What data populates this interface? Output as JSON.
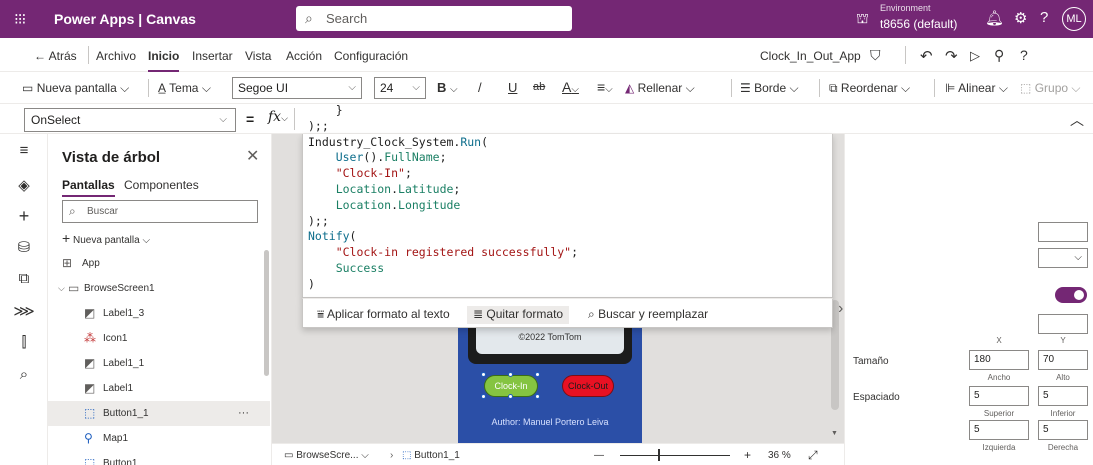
{
  "header": {
    "waffle": "⁝⁝⁝",
    "app_title": "Power Apps  |  Canvas",
    "search_placeholder": "Search",
    "env_label": "Environment",
    "env_name": "t8656 (default)",
    "avatar": "ML"
  },
  "menubar": {
    "back": "Atrás",
    "items": [
      "Archivo",
      "Inicio",
      "Insertar",
      "Vista",
      "Acción",
      "Configuración"
    ],
    "active": "Inicio",
    "app_name": "Clock_In_Out_App"
  },
  "ribbon": {
    "new_screen": "Nueva pantalla",
    "theme": "Tema",
    "font": "Segoe UI",
    "font_size": "24",
    "bold": "B",
    "italic": "/",
    "underline": "U",
    "strike": "ab",
    "font_color": "A",
    "align": "≡",
    "fill": "Rellenar",
    "border": "Borde",
    "reorder": "Reordenar",
    "align_label": "Alinear",
    "group": "Grupo"
  },
  "formulabar": {
    "property": "OnSelect",
    "equals": "=",
    "fx": "fx"
  },
  "editor": {
    "lines": [
      "    }",
      ");;",
      "Industry_Clock_System.Run(",
      "    User().FullName;",
      "    \"Clock-In\";",
      "    Location.Latitude;",
      "    Location.Longitude",
      ");;",
      "Notify(",
      "    \"Clock-in registered successfully\";",
      "    Success",
      ")"
    ],
    "actions": {
      "format": "Aplicar formato al texto",
      "unformat": "Quitar formato",
      "find": "Buscar y reemplazar"
    }
  },
  "tree": {
    "title": "Vista de árbol",
    "tab_screens": "Pantallas",
    "tab_components": "Componentes",
    "search_placeholder": "Buscar",
    "new_screen": "Nueva pantalla",
    "items": [
      {
        "label": "App",
        "indent": 0
      },
      {
        "label": "BrowseScreen1",
        "indent": 0
      },
      {
        "label": "Label1_3",
        "indent": 1
      },
      {
        "label": "Icon1",
        "indent": 1
      },
      {
        "label": "Label1_1",
        "indent": 1
      },
      {
        "label": "Label1",
        "indent": 1
      },
      {
        "label": "Button1_1",
        "indent": 1
      },
      {
        "label": "Map1",
        "indent": 1
      },
      {
        "label": "Button1",
        "indent": 1
      }
    ],
    "more": "···"
  },
  "canvas": {
    "map_copyright": "©2022 TomTom",
    "clock_in": "Clock-In",
    "clock_out": "Clock-Out",
    "author": "Author: Manuel Portero Leiva"
  },
  "statusbar": {
    "screen": "BrowseScre...",
    "control": "Button1_1",
    "minus": "—",
    "plus": "+",
    "zoom": "36 %"
  },
  "props": {
    "x_label": "X",
    "y_label": "Y",
    "size_label": "Tamaño",
    "width_val": "180",
    "height_val": "70",
    "width_label": "Ancho",
    "height_label": "Alto",
    "padding_label": "Espaciado",
    "top_val": "5",
    "bottom_val": "5",
    "top_label": "Superior",
    "bottom_label": "Inferior",
    "left_val": "5",
    "right_val": "5",
    "left_label": "Izquierda",
    "right_label": "Derecha"
  },
  "colors": {
    "brand": "#742774",
    "clock_in": "#85c441",
    "clock_out": "#e81123",
    "screen_bg": "#2b4fa7"
  }
}
